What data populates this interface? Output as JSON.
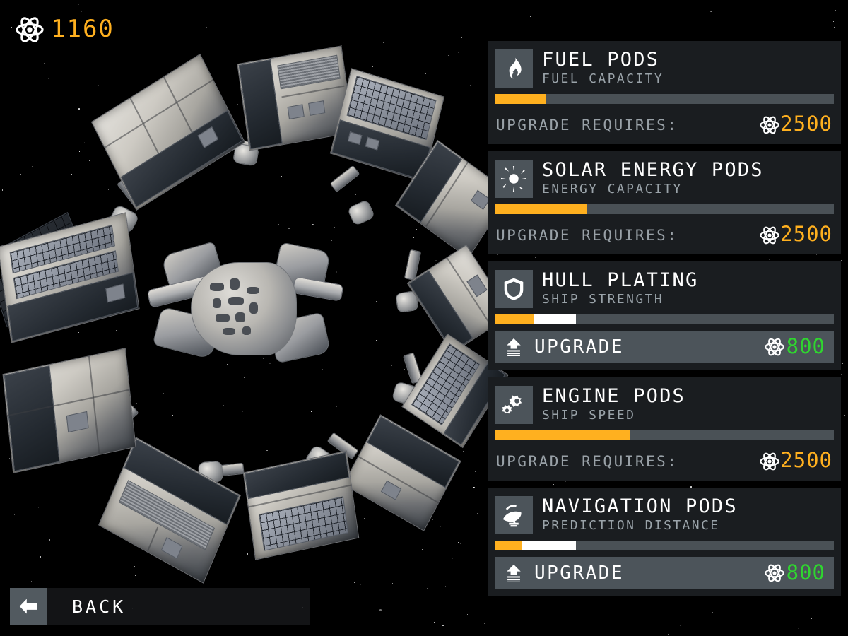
{
  "currency": {
    "icon": "atom-icon",
    "amount": "1160",
    "color": "#ffb01f"
  },
  "back_button": {
    "label": "BACK",
    "icon": "arrow-left-icon"
  },
  "colors": {
    "accent_orange": "#ffb01f",
    "ready_green": "#2fd62f",
    "panel_bg": "#1a1d20",
    "tile_bg": "#4c545a",
    "track_bg": "#4a5156",
    "subtitle_gray": "#9aa3a9"
  },
  "labels": {
    "upgrade_requires": "UPGRADE REQUIRES:",
    "upgrade": "UPGRADE"
  },
  "panels": [
    {
      "icon": "flame-icon",
      "title": "FUEL PODS",
      "subtitle": "FUEL CAPACITY",
      "bar": {
        "current_pct": 15,
        "preview_pct": 0
      },
      "state": "locked",
      "requires_label": "UPGRADE REQUIRES:",
      "cost": "2500"
    },
    {
      "icon": "sun-icon",
      "title": "SOLAR ENERGY PODS",
      "subtitle": "ENERGY CAPACITY",
      "bar": {
        "current_pct": 27,
        "preview_pct": 0
      },
      "state": "locked",
      "requires_label": "UPGRADE REQUIRES:",
      "cost": "2500"
    },
    {
      "icon": "shield-icon",
      "title": "HULL PLATING",
      "subtitle": "SHIP STRENGTH",
      "bar": {
        "current_pct": 11.5,
        "preview_pct": 12.5
      },
      "state": "ready",
      "button_label": "UPGRADE",
      "cost": "800"
    },
    {
      "icon": "gears-icon",
      "title": "ENGINE PODS",
      "subtitle": "SHIP SPEED",
      "bar": {
        "current_pct": 40,
        "preview_pct": 0
      },
      "state": "locked",
      "requires_label": "UPGRADE REQUIRES:",
      "cost": "2500"
    },
    {
      "icon": "satellite-dish-icon",
      "title": "NAVIGATION PODS",
      "subtitle": "PREDICTION DISTANCE",
      "bar": {
        "current_pct": 8,
        "preview_pct": 16
      },
      "state": "ready",
      "button_label": "UPGRADE",
      "cost": "800"
    }
  ],
  "scene": {
    "name": "modular-spaceship-render",
    "description": "ring of cargo/solar pods around a central hull core on a starfield"
  }
}
